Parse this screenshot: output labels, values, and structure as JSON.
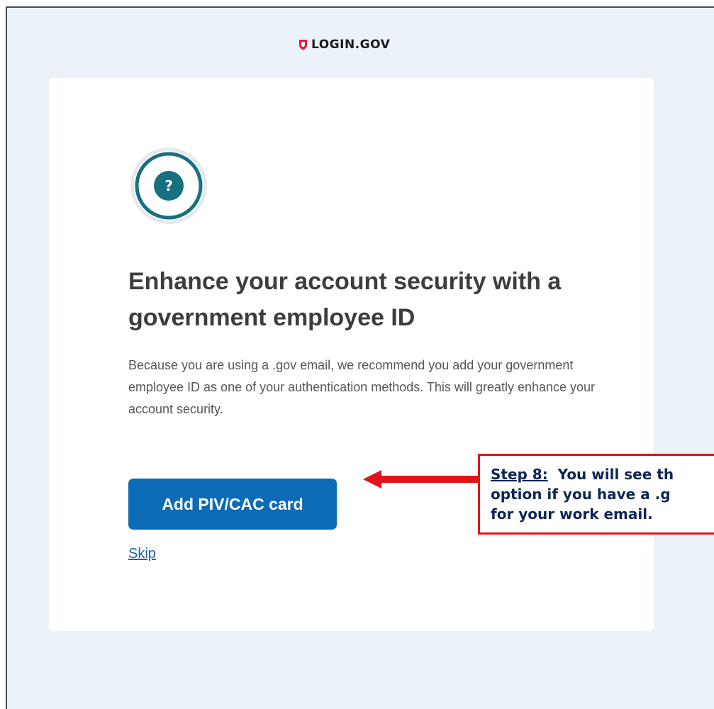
{
  "header": {
    "logo_text": "LOGIN.GOV",
    "logo_icon": "shield-icon"
  },
  "card": {
    "badge_icon": "question-mark-icon",
    "badge_glyph": "?",
    "heading": "Enhance your account security with a government employee ID",
    "intro": "Because you are using a .gov email, we recommend you add your government employee ID as one of your authentication methods. This will greatly enhance your account security.",
    "add_button_label": "Add PIV/CAC card",
    "skip_link_label": "Skip"
  },
  "callout": {
    "step_label": "Step 8:",
    "line1_text": "You will see th",
    "line2_text": "option if you have a .g",
    "line3_text": "for your work email."
  },
  "colors": {
    "page_background": "#ecf2f9",
    "card_background": "#ffffff",
    "primary_button": "#0b6bb6",
    "badge_teal": "#17707f",
    "link": "#1f5fa8",
    "shield_red": "#e21c3d",
    "callout_border": "#e5121c",
    "callout_text": "#0f2556"
  }
}
